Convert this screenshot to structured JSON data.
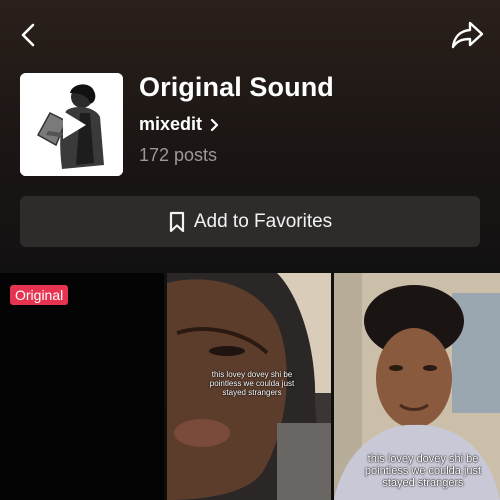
{
  "header": {
    "back_icon": "chevron-left-icon",
    "share_icon": "share-arrow-icon"
  },
  "sound": {
    "title": "Original Sound",
    "author": "mixedit",
    "posts": "172 posts",
    "cover_icon": "play-icon"
  },
  "favorites": {
    "label": "Add to Favorites",
    "icon": "bookmark-icon"
  },
  "videos": [
    {
      "badge": "Original",
      "caption": ""
    },
    {
      "caption": "this lovey dovey shi be pointless we coulda just stayed strangers"
    },
    {
      "caption": "this lovey dovey shi be pointless we coulda just stayed strangers"
    }
  ],
  "colors": {
    "badge": "#e6334f",
    "button_bg": "#2e2c2b",
    "muted_text": "#9c9896"
  }
}
